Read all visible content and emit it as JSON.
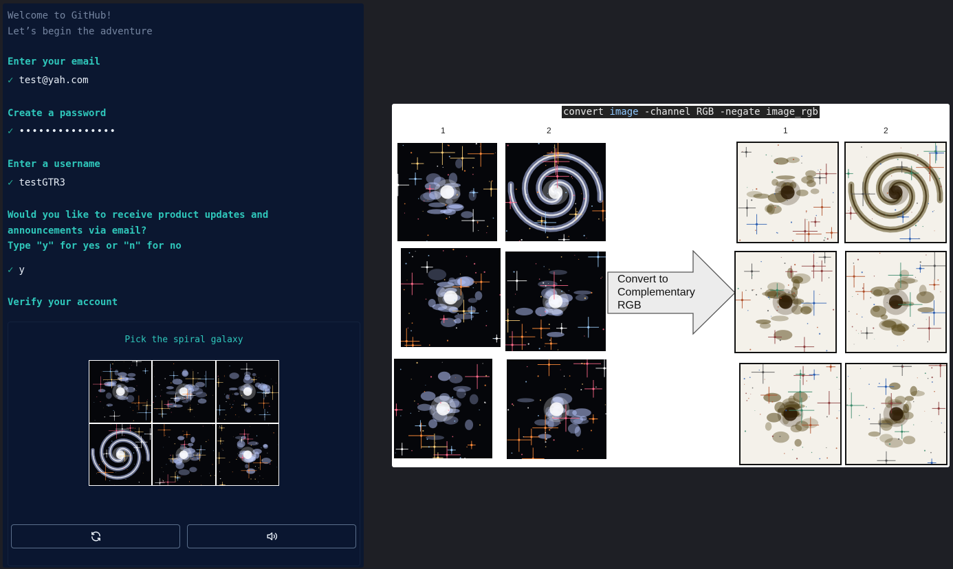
{
  "signup": {
    "intro": [
      "Welcome to GitHub!",
      "Let’s begin the adventure"
    ],
    "check_mark": "✓",
    "email": {
      "prompt": "Enter your email",
      "value": "test@yah.com"
    },
    "password": {
      "prompt": "Create a password",
      "value": "•••••••••••••••"
    },
    "username": {
      "prompt": "Enter a username",
      "value": "testGTR3"
    },
    "updates": {
      "prompt_line1": "Would you like to receive product updates and",
      "prompt_line2": "announcements via email?",
      "prompt_line3": "Type \"y\" for yes or \"n\" for no",
      "value": "y"
    },
    "verify_prompt": "Verify your account"
  },
  "captcha": {
    "instruction": "Pick the spiral galaxy",
    "tiles": [
      "galaxy-image",
      "galaxy-image",
      "galaxy-image",
      "spiral-galaxy-image",
      "galaxy-image",
      "galaxy-image"
    ],
    "refresh_icon": "refresh-icon",
    "audio_icon": "speaker-icon"
  },
  "figure": {
    "command_parts": [
      "convert ",
      "image",
      " -channel RGB -negate image_rgb"
    ],
    "left_columns": [
      "1",
      "2"
    ],
    "right_columns": [
      "1",
      "2"
    ],
    "arrow_label_lines": [
      "Convert to",
      "Complementary",
      "RGB"
    ]
  },
  "colors": {
    "panel_bg": "#0b1730",
    "accent_teal": "#2fc7bb",
    "page_bg": "#1e1f25"
  }
}
